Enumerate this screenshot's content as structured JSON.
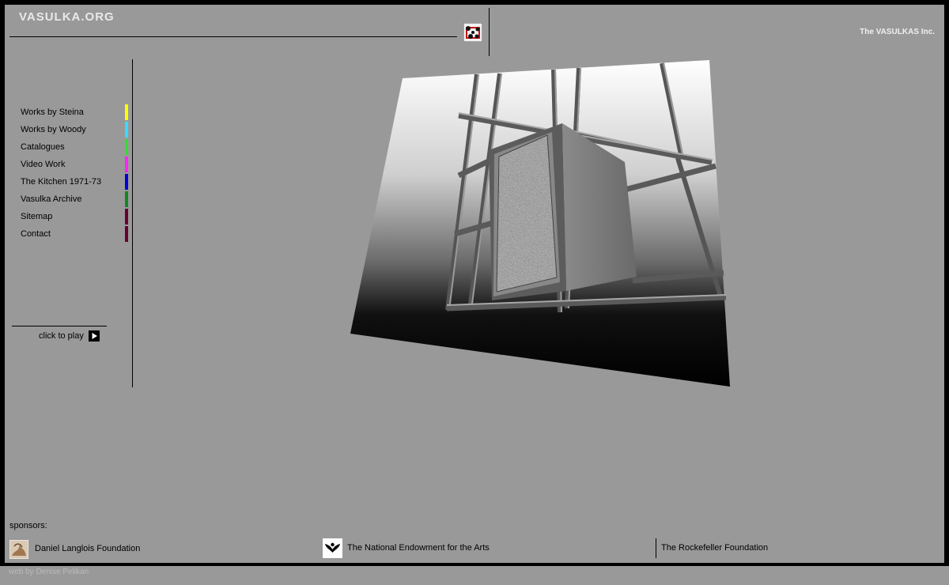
{
  "header": {
    "site_title": "VASULKA.ORG",
    "company": "The VASULKAS Inc."
  },
  "nav": {
    "items": [
      {
        "label": "Works by Steina",
        "color": "#ffff00"
      },
      {
        "label": "Works by Woody",
        "color": "#33ddff"
      },
      {
        "label": "Catalogues",
        "color": "#33dd33"
      },
      {
        "label": "Video Work",
        "color": "#ff22ff"
      },
      {
        "label": "The Kitchen 1971-73",
        "color": "#0000dd"
      },
      {
        "label": "Vasulka Archive",
        "color": "#118822"
      },
      {
        "label": "Sitemap",
        "color": "#660033"
      },
      {
        "label": "Contact",
        "color": "#660033"
      }
    ]
  },
  "player": {
    "label": "click to play",
    "icon": "play-icon"
  },
  "sponsors": {
    "label": "sponsors:",
    "items": [
      {
        "name": "Daniel Langlois Foundation",
        "icon": "langlois-foundation-icon"
      },
      {
        "name": "The National Endowment for the Arts",
        "icon": "nea-icon"
      },
      {
        "name": "The Rockefeller Foundation"
      }
    ]
  },
  "footer": {
    "credit": "web by Denise Pelikan"
  }
}
